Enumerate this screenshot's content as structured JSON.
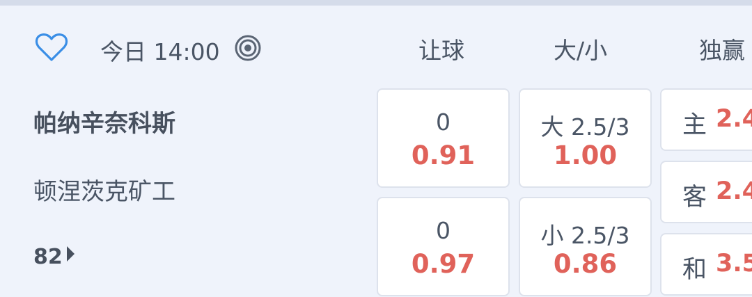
{
  "header": {
    "favorite_icon": "heart-outline-icon",
    "time": "今日 14:00",
    "live_icon": "target-icon",
    "columns": [
      "让球",
      "大/小",
      "独赢"
    ]
  },
  "match": {
    "home_team": "帕纳辛奈科斯",
    "away_team": "顿涅茨克矿工",
    "more_count": "82"
  },
  "handicap": {
    "home": {
      "line": "0",
      "odds": "0.91"
    },
    "away": {
      "line": "0",
      "odds": "0.97"
    }
  },
  "over_under": {
    "over": {
      "line": "大 2.5/3",
      "odds": "1.00"
    },
    "under": {
      "line": "小 2.5/3",
      "odds": "0.86"
    }
  },
  "moneyline": {
    "home": {
      "label": "主",
      "odds": "2.4"
    },
    "away": {
      "label": "客",
      "odds": "2.4"
    },
    "draw": {
      "label": "和",
      "odds": "3.5"
    }
  },
  "colors": {
    "background": "#eff3fb",
    "accent_blue": "#3a8ee6",
    "odds_red": "#e0625a",
    "text": "#4a5565"
  }
}
